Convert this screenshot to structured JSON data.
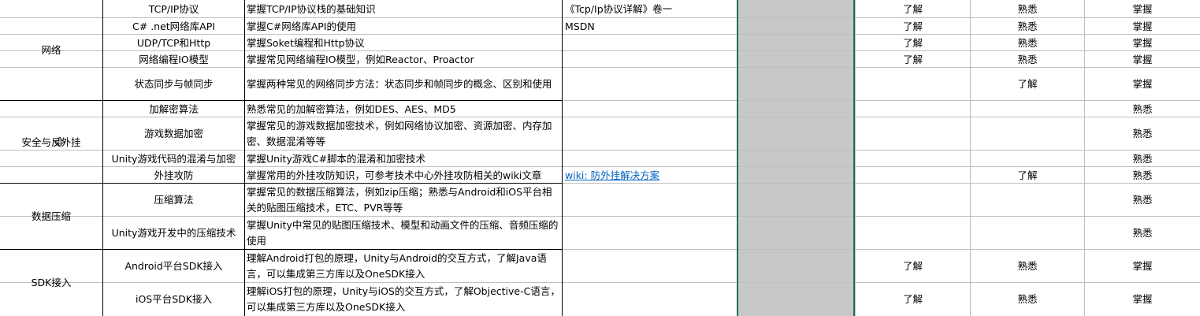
{
  "sheet": {
    "groups": [
      {
        "label": "网络",
        "rows": [
          0,
          4
        ]
      },
      {
        "label": "安全与反外挂",
        "rows": [
          5,
          8
        ]
      },
      {
        "label": "数据压缩",
        "rows": [
          9,
          10
        ]
      },
      {
        "label": "SDK接入",
        "rows": [
          11,
          12
        ]
      }
    ],
    "rows": [
      {
        "topic": "TCP/IP协议",
        "desc": "掌握TCP/IP协议栈的基础知识",
        "ref": "《Tcp/Ip协议详解》卷一",
        "ref_link": false,
        "l1": "了解",
        "l2": "熟悉",
        "l3": "掌握"
      },
      {
        "topic": "C# .net网络库API",
        "desc": "掌握C#网络库API的使用",
        "ref": "MSDN",
        "ref_link": false,
        "l1": "了解",
        "l2": "熟悉",
        "l3": "掌握"
      },
      {
        "topic": "UDP/TCP和Http",
        "desc": "掌握Soket编程和Http协议",
        "ref": "",
        "ref_link": false,
        "l1": "了解",
        "l2": "熟悉",
        "l3": "掌握"
      },
      {
        "topic": "网络编程IO模型",
        "desc": "掌握常见网络编程IO模型，例如Reactor、Proactor",
        "ref": "",
        "ref_link": false,
        "l1": "了解",
        "l2": "熟悉",
        "l3": "掌握"
      },
      {
        "topic": "状态同步与帧同步",
        "desc": "掌握两种常见的网络同步方法：状态同步和帧同步的概念、区别和使用",
        "ref": "",
        "ref_link": false,
        "l1": "",
        "l2": "了解",
        "l3": "掌握"
      },
      {
        "topic": "加解密算法",
        "desc": "熟悉常见的加解密算法，例如DES、AES、MD5",
        "ref": "",
        "ref_link": false,
        "l1": "",
        "l2": "",
        "l3": "熟悉"
      },
      {
        "topic": "游戏数据加密",
        "desc": "掌握常见的游戏数据加密技术，例如网络协议加密、资源加密、内存加密、数据混淆等等",
        "ref": "",
        "ref_link": false,
        "l1": "",
        "l2": "",
        "l3": "熟悉"
      },
      {
        "topic": "Unity游戏代码的混淆与加密",
        "desc": "掌握Unity游戏C#脚本的混淆和加密技术",
        "ref": "",
        "ref_link": false,
        "l1": "",
        "l2": "",
        "l3": "熟悉"
      },
      {
        "topic": "外挂攻防",
        "desc": "掌握常用的外挂攻防知识，可参考技术中心外挂攻防相关的wiki文章",
        "ref": "wiki: 防外挂解决方案",
        "ref_link": true,
        "l1": "",
        "l2": "了解",
        "l3": "熟悉"
      },
      {
        "topic": "压缩算法",
        "desc": "掌握常见的数据压缩算法，例如zip压缩；熟悉与Android和iOS平台相关的贴图压缩技术，ETC、PVR等等",
        "ref": "",
        "ref_link": false,
        "l1": "",
        "l2": "",
        "l3": "熟悉"
      },
      {
        "topic": "Unity游戏开发中的压缩技术",
        "desc": "掌握Unity中常见的贴图压缩技术、模型和动画文件的压缩、音频压缩的使用",
        "ref": "",
        "ref_link": false,
        "l1": "",
        "l2": "",
        "l3": "熟悉"
      },
      {
        "topic": "Android平台SDK接入",
        "desc": "理解Android打包的原理，Unity与Android的交互方式，了解Java语言，可以集成第三方库以及OneSDK接入",
        "ref": "",
        "ref_link": false,
        "l1": "了解",
        "l2": "熟悉",
        "l3": "掌握"
      },
      {
        "topic": "iOS平台SDK接入",
        "desc": "理解iOS打包的原理，Unity与iOS的交互方式，了解Objective-C语言，可以集成第三方库以及OneSDK接入",
        "ref": "",
        "ref_link": false,
        "l1": "了解",
        "l2": "熟悉",
        "l3": "掌握"
      }
    ]
  }
}
